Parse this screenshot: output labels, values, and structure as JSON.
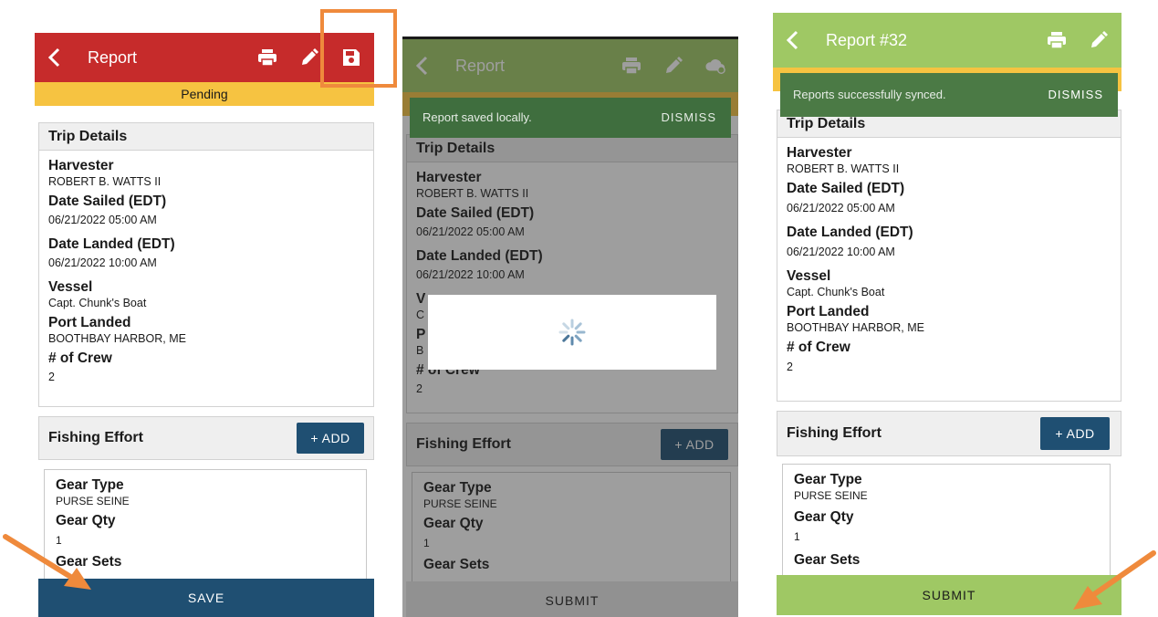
{
  "colors": {
    "red_bar": "#c62b2b",
    "green_bar": "#9fc864",
    "pending_bar": "#f6c341",
    "navy_button": "#1f4f72",
    "toast_green": "#3f6e3e",
    "annotation_orange": "#ef8a3c"
  },
  "screen1": {
    "title": "Report",
    "status": "Pending",
    "trip_header": "Trip Details",
    "harvester_label": "Harvester",
    "harvester_value": "ROBERT B. WATTS II",
    "date_sailed_label": "Date Sailed (EDT)",
    "date_sailed_value": "06/21/2022 05:00 AM",
    "date_landed_label": "Date Landed (EDT)",
    "date_landed_value": "06/21/2022 10:00 AM",
    "vessel_label": "Vessel",
    "vessel_value": "Capt. Chunk's Boat",
    "port_label": "Port Landed",
    "port_value": "BOOTHBAY HARBOR, ME",
    "crew_label": "# of Crew",
    "crew_value": "2",
    "effort_header": "Fishing Effort",
    "add_label": "+ ADD",
    "gear_type_label": "Gear Type",
    "gear_type_value": "PURSE SEINE",
    "gear_qty_label": "Gear Qty",
    "gear_qty_value": "1",
    "gear_sets_label": "Gear Sets",
    "bottom_button": "SAVE",
    "icons": [
      "back-icon",
      "print-icon",
      "edit-icon",
      "save-icon"
    ]
  },
  "screen2": {
    "title": "Report",
    "toast_text": "Report saved locally.",
    "toast_action": "DISMISS",
    "trip_header": "Trip Details",
    "harvester_label": "Harvester",
    "harvester_value": "ROBERT B. WATTS II",
    "date_sailed_label": "Date Sailed (EDT)",
    "date_sailed_value": "06/21/2022 05:00 AM",
    "date_landed_label": "Date Landed (EDT)",
    "date_landed_value": "06/21/2022 10:00 AM",
    "vessel_partial": "V",
    "vessel_value_partial": "C",
    "port_partial": "P",
    "port_value_partial": "B",
    "crew_label": "# of Crew",
    "crew_value": "2",
    "effort_header": "Fishing Effort",
    "add_label": "+ ADD",
    "gear_type_label": "Gear Type",
    "gear_type_value": "PURSE SEINE",
    "gear_qty_label": "Gear Qty",
    "gear_qty_value": "1",
    "gear_sets_label": "Gear Sets",
    "bottom_button": "SUBMIT",
    "icons": [
      "back-icon",
      "print-icon",
      "edit-icon",
      "cloud-sync-icon",
      "loading-spinner-icon"
    ]
  },
  "screen3": {
    "title": "Report #32",
    "toast_text": "Reports successfully synced.",
    "toast_action": "DISMISS",
    "trip_header": "Trip Details",
    "harvester_label": "Harvester",
    "harvester_value": "ROBERT B. WATTS II",
    "date_sailed_label": "Date Sailed (EDT)",
    "date_sailed_value": "06/21/2022 05:00 AM",
    "date_landed_label": "Date Landed (EDT)",
    "date_landed_value": "06/21/2022 10:00 AM",
    "vessel_label": "Vessel",
    "vessel_value": "Capt. Chunk's Boat",
    "port_label": "Port Landed",
    "port_value": "BOOTHBAY HARBOR, ME",
    "crew_label": "# of Crew",
    "crew_value": "2",
    "effort_header": "Fishing Effort",
    "add_label": "+ ADD",
    "gear_type_label": "Gear Type",
    "gear_type_value": "PURSE SEINE",
    "gear_qty_label": "Gear Qty",
    "gear_qty_value": "1",
    "gear_sets_label": "Gear Sets",
    "bottom_button": "SUBMIT",
    "icons": [
      "back-icon",
      "print-icon",
      "edit-icon"
    ]
  }
}
